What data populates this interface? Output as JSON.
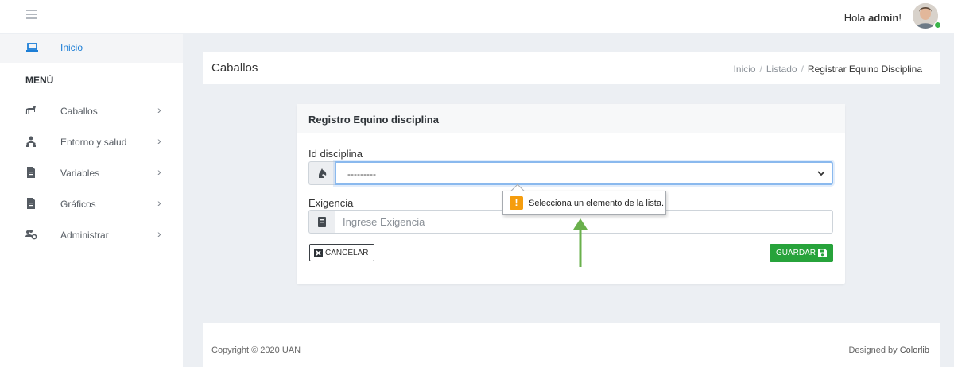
{
  "topbar": {
    "greeting_prefix": "Hola ",
    "username": "admin",
    "greeting_suffix": "!"
  },
  "sidebar": {
    "home_label": "Inicio",
    "menu_heading": "MENÚ",
    "items": [
      {
        "label": "Caballos",
        "icon": "horse-icon"
      },
      {
        "label": "Entorno y salud",
        "icon": "users-icon"
      },
      {
        "label": "Variables",
        "icon": "file-icon"
      },
      {
        "label": "Gráficos",
        "icon": "file-icon"
      },
      {
        "label": "Administrar",
        "icon": "users-cog-icon"
      }
    ]
  },
  "header": {
    "title": "Caballos",
    "breadcrumb": [
      "Inicio",
      "Listado",
      "Registrar Equino Disciplina"
    ]
  },
  "form": {
    "title": "Registro Equino disciplina",
    "discipline_label": "Id disciplina",
    "discipline_value": "---------",
    "requirement_label": "Exigencia",
    "requirement_placeholder": "Ingrese Exigencia",
    "cancel_label": "CANCELAR",
    "save_label": "GUARDAR"
  },
  "tooltip": {
    "message": "Selecciona un elemento de la lista."
  },
  "footer": {
    "copyright": "Copyright © 2020 UAN",
    "designed_prefix": "Designed by ",
    "designed_link": "Colorlib"
  },
  "colors": {
    "accent": "#1c7ed6",
    "success": "#27a33b",
    "warning": "#f59d0e",
    "annotation_arrow": "#6ab04c"
  }
}
